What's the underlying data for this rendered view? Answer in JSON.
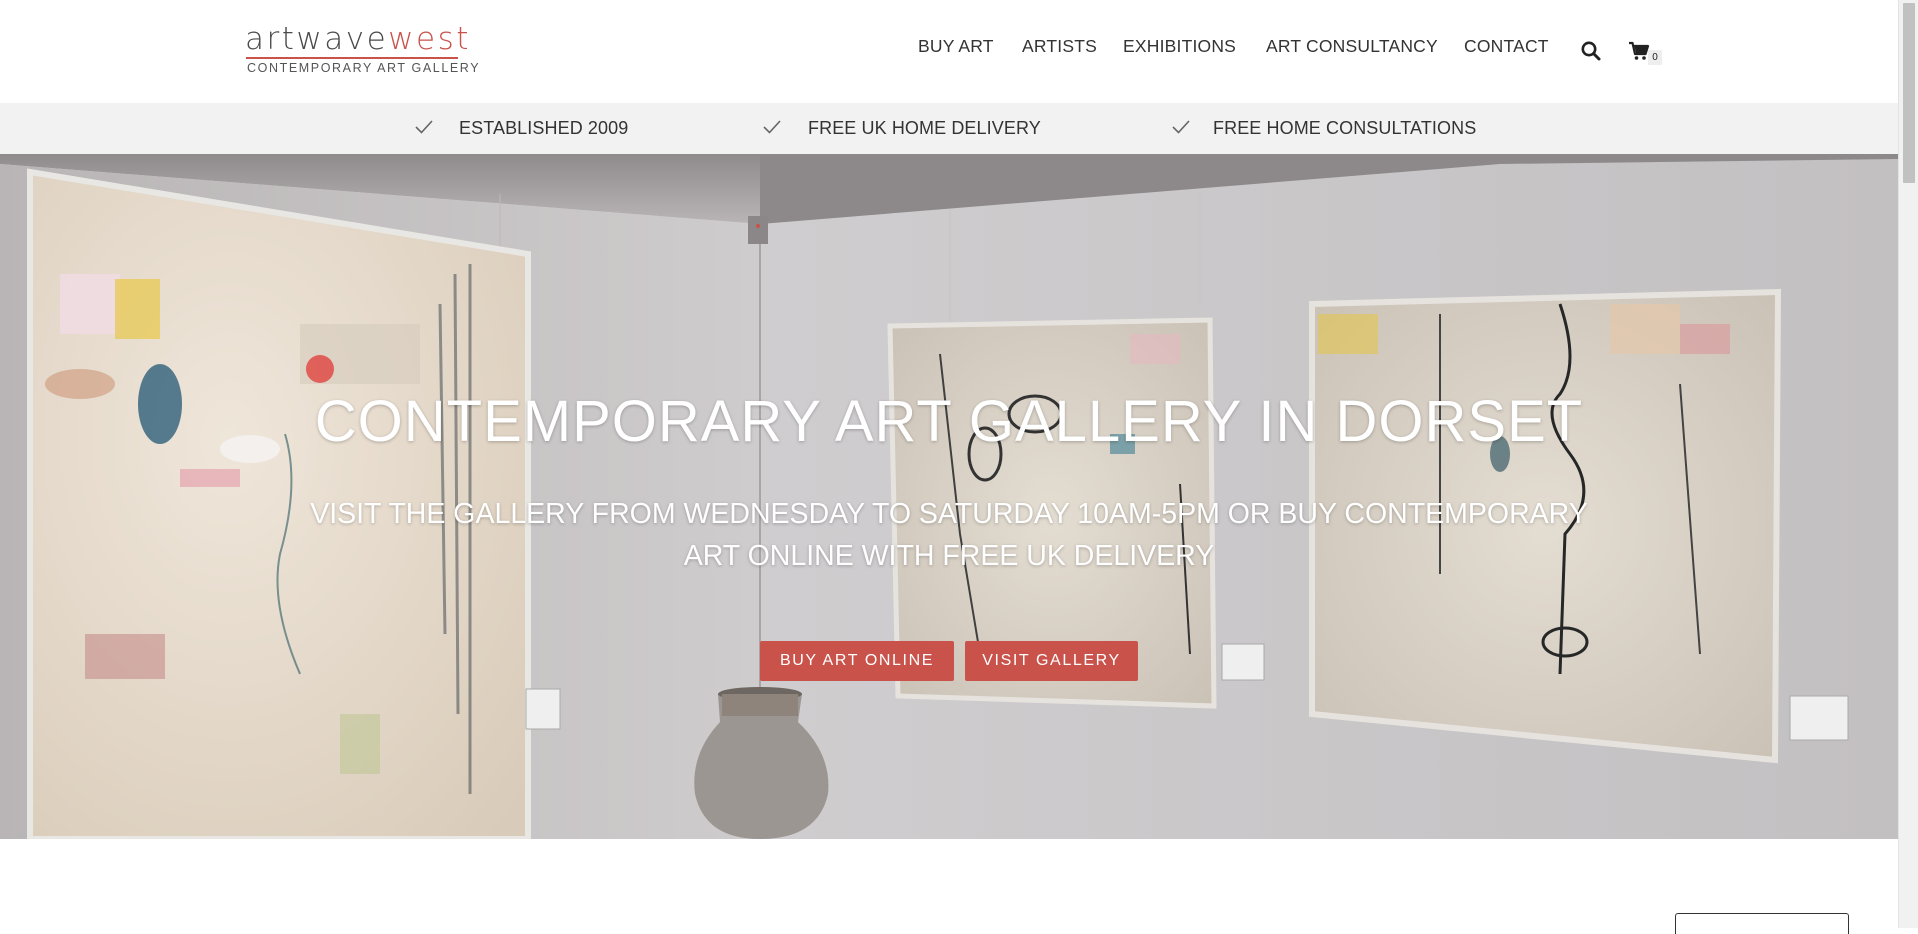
{
  "logo": {
    "word_a": "artwave",
    "word_b": "west",
    "tagline": "CONTEMPORARY ART GALLERY"
  },
  "nav": {
    "items": [
      {
        "label": "BUY ART"
      },
      {
        "label": "ARTISTS"
      },
      {
        "label": "EXHIBITIONS"
      },
      {
        "label": "ART CONSULTANCY"
      },
      {
        "label": "CONTACT"
      }
    ],
    "search_icon": "search-icon",
    "cart_icon": "cart-icon",
    "cart_count": "0"
  },
  "features": [
    {
      "icon": "check-icon",
      "label": "ESTABLISHED 2009"
    },
    {
      "icon": "check-icon",
      "label": "FREE UK HOME DELIVERY"
    },
    {
      "icon": "check-icon",
      "label": "FREE HOME CONSULTATIONS"
    }
  ],
  "hero": {
    "title": "CONTEMPORARY ART GALLERY IN DORSET",
    "subtitle": "VISIT THE GALLERY FROM WEDNESDAY TO SATURDAY 10AM-5PM OR BUY CONTEMPORARY ART ONLINE WITH FREE UK DELIVERY",
    "buttons": [
      {
        "label": "BUY ART ONLINE"
      },
      {
        "label": "VISIT GALLERY"
      }
    ]
  },
  "colors": {
    "accent": "#c9524b",
    "feature_bar": "#f2f2f2",
    "text": "#333333"
  }
}
